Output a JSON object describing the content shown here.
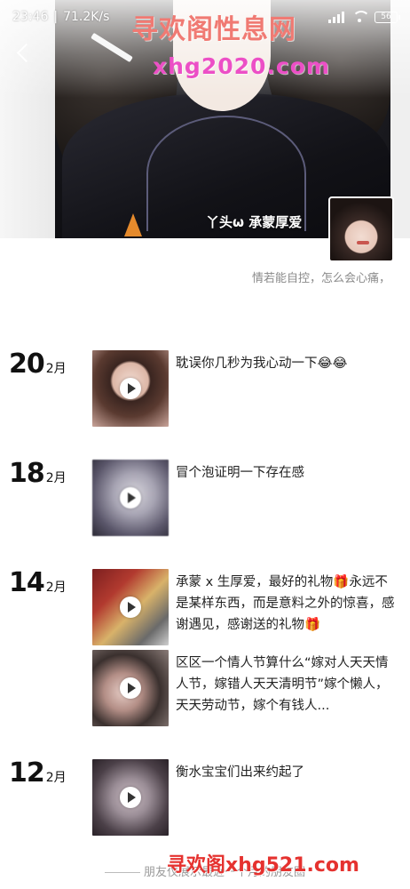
{
  "status_bar": {
    "time": "23:46",
    "net_speed": "71.2K/s",
    "battery": "56"
  },
  "watermarks": {
    "top_title": "寻欢阁性息网",
    "top_url": "xhg2020.com",
    "bottom": "寻欢阁xhg521.com"
  },
  "profile": {
    "name": "丫头ω 承蒙厚爱",
    "signature": "情若能自控，怎么会心痛，"
  },
  "timeline": [
    {
      "day": "20",
      "month": "2月",
      "posts": [
        {
          "text": "耽误你几秒为我心动一下😂😂",
          "video": true
        }
      ]
    },
    {
      "day": "18",
      "month": "2月",
      "posts": [
        {
          "text": "冒个泡证明一下存在感",
          "video": true
        }
      ]
    },
    {
      "day": "14",
      "month": "2月",
      "posts": [
        {
          "text": "承蒙 x 生厚爱，最好的礼物🎁永远不是某样东西，而是意料之外的惊喜，感谢遇见，感谢送的礼物🎁",
          "video": true
        },
        {
          "text": "区区一个情人节算什么“嫁对人天天情人节，嫁错人天天清明节”嫁个懒人，天天劳动节，嫁个有钱人...",
          "video": true
        }
      ]
    },
    {
      "day": "12",
      "month": "2月",
      "posts": [
        {
          "text": "衡水宝宝们出来约起了",
          "video": true
        }
      ]
    }
  ],
  "footer": {
    "note": "朋友仅展示最近一个月的朋友圈"
  }
}
